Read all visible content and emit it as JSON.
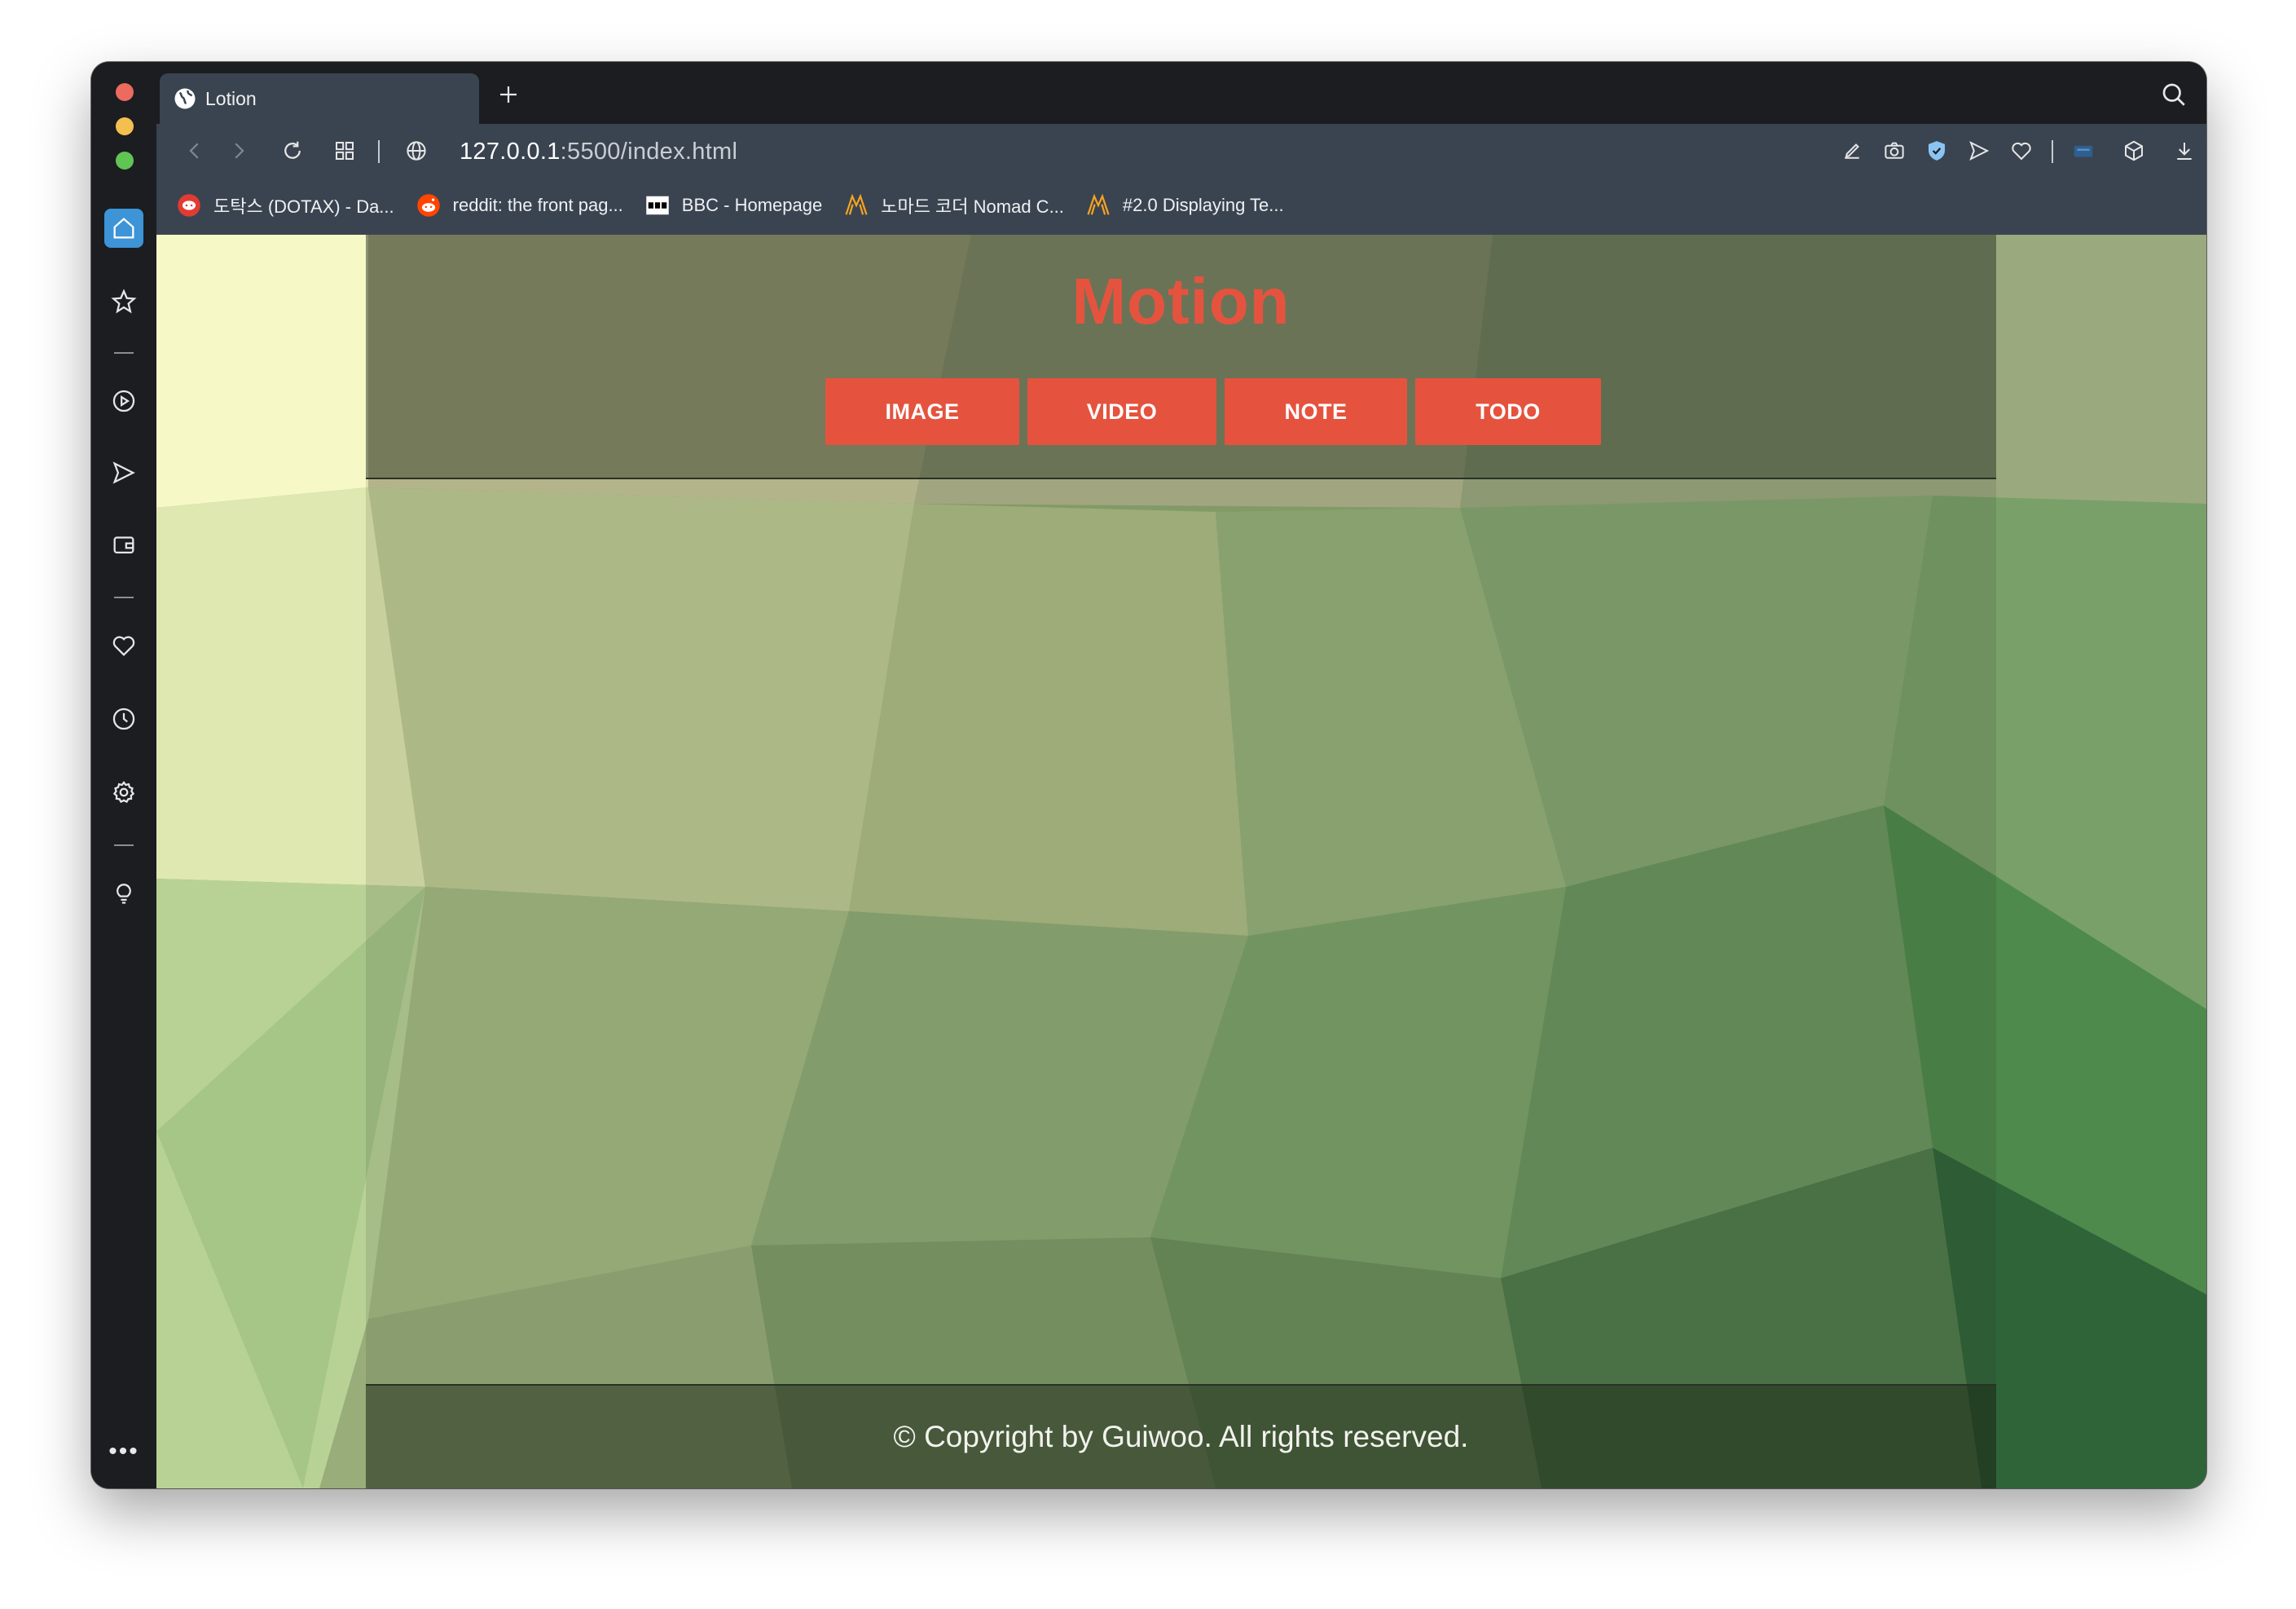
{
  "browser": {
    "tab": {
      "title": "Lotion"
    },
    "address": {
      "host": "127.0.0.1",
      "rest": ":5500/index.html"
    },
    "bookmarks": [
      {
        "label": "도탁스 (DOTAX) - Da...",
        "icon": "dotax-favicon"
      },
      {
        "label": "reddit: the front pag...",
        "icon": "reddit-favicon"
      },
      {
        "label": "BBC - Homepage",
        "icon": "bbc-favicon"
      },
      {
        "label": "노마드 코더 Nomad C...",
        "icon": "nomad-favicon"
      },
      {
        "label": "#2.0 Displaying Te...",
        "icon": "nomad-favicon"
      }
    ],
    "sidebar_icons": [
      "home-icon",
      "star-icon",
      "play-icon",
      "send-icon",
      "wallet-icon",
      "heart-icon",
      "clock-icon",
      "gear-icon",
      "lightbulb-icon",
      "more-icon"
    ],
    "more_label": "•••"
  },
  "page": {
    "logo": "Motion",
    "buttons": {
      "image": "IMAGE",
      "video": "VIDEO",
      "note": "NOTE",
      "todo": "TODO"
    },
    "footer": "© Copyright by Guiwoo. All rights reserved."
  },
  "colors": {
    "accent": "#e5533f",
    "chrome_dark": "#1b1d20",
    "chrome_toolbar": "#3a4450",
    "sidebar_active": "#3d94d6"
  }
}
